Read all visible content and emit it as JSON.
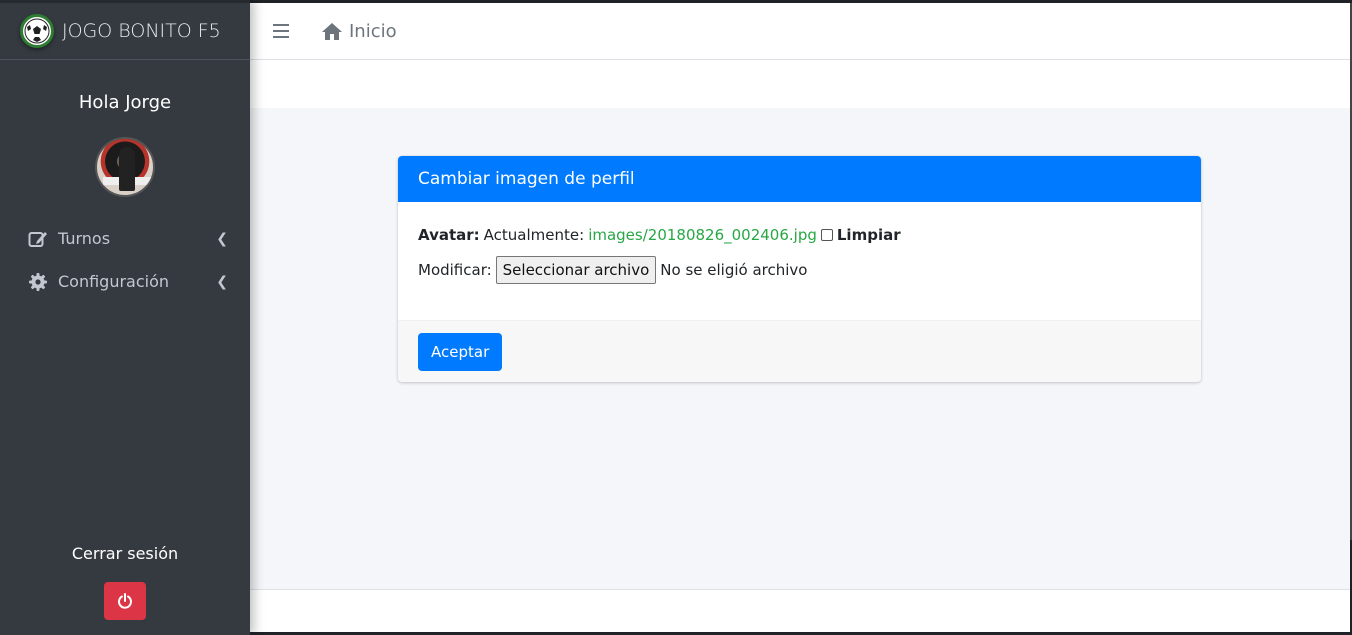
{
  "sidebar": {
    "brand": "JOGO BONITO F5",
    "greeting": "Hola Jorge",
    "items": [
      {
        "label": "Turnos",
        "icon": "edit-icon"
      },
      {
        "label": "Configuración",
        "icon": "gear-icon"
      }
    ],
    "logout_label": "Cerrar sesión"
  },
  "topbar": {
    "home_label": "Inicio"
  },
  "card": {
    "title": "Cambiar imagen de perfil",
    "avatar_label": "Avatar:",
    "current_label": "Actualmente:",
    "current_file": "images/20180826_002406.jpg",
    "clear_label": "Limpiar",
    "modify_label": "Modificar:",
    "file_button": "Seleccionar archivo",
    "no_file": "No se eligió archivo",
    "submit": "Aceptar"
  },
  "colors": {
    "primary": "#007bff",
    "sidebar": "#343a40",
    "danger": "#dc3545",
    "link": "#28a745"
  }
}
